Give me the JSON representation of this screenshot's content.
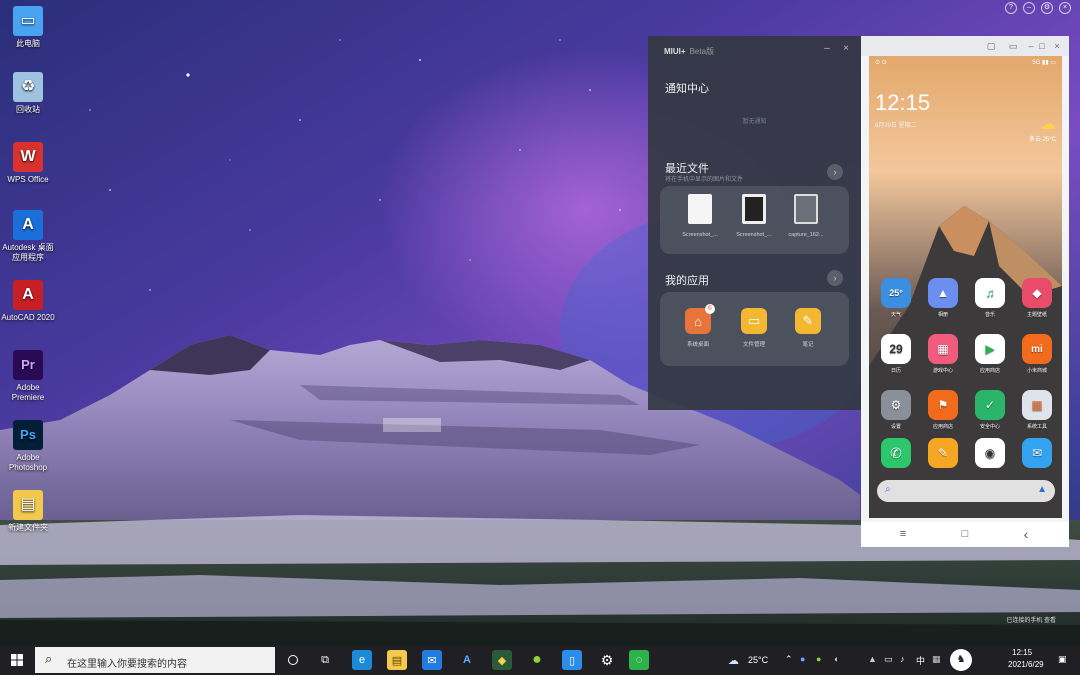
{
  "desktop": {
    "icons": [
      {
        "label": "此电脑",
        "icon": "computer-icon",
        "color": "#4aa3f0"
      },
      {
        "label": "回收站",
        "icon": "recycle-bin-icon",
        "color": "#9fc2e0"
      },
      {
        "label": "WPS Office",
        "icon": "wps-icon",
        "color": "#d9322e"
      },
      {
        "label": "Autodesk 桌面应用程序",
        "icon": "autodesk-icon",
        "color": "#1b6fd8"
      },
      {
        "label": "AutoCAD 2020",
        "icon": "autocad-icon",
        "color": "#c81f25"
      },
      {
        "label": "Adobe Premiere",
        "icon": "premiere-icon",
        "color": "#2a0a55"
      },
      {
        "label": "Adobe Photoshop",
        "icon": "photoshop-icon",
        "color": "#031e36"
      },
      {
        "label": "新建文件夹",
        "icon": "folder-icon",
        "color": "#f2c94c"
      }
    ],
    "wallpaper_label": "",
    "pc_notice": "已连接的手机 查看"
  },
  "miui_panel": {
    "title": "MIUI+",
    "beta": "Beta版",
    "notification_title": "通知中心",
    "notification_empty": "暂无通知",
    "recent_files_title": "最近文件",
    "recent_files_sub": "将在手机中显示的图片和文件",
    "files": [
      {
        "name": "Screenshot_...",
        "thumb_color": "#f5f5f5"
      },
      {
        "name": "Screenshot_...",
        "thumb_color": "#222222"
      },
      {
        "name": "capture_162...",
        "thumb_color": "#6b7078"
      }
    ],
    "my_apps_title": "我的应用",
    "apps": [
      {
        "name": "系统桌面",
        "icon": "home-icon",
        "color": "#e8743b",
        "badge": "6"
      },
      {
        "name": "文件管理",
        "icon": "folder-icon",
        "color": "#f4b731"
      },
      {
        "name": "笔记",
        "icon": "notes-icon",
        "color": "#f4b731"
      }
    ]
  },
  "phone": {
    "status_left": "⊙ ⊙",
    "status_right": "5G ▮▮ ▭",
    "time": "12:15",
    "date": "6月29日 星期二",
    "weather": "多云 25°C",
    "apps": [
      {
        "name": "天气",
        "label": "25°",
        "color": "#3a8fe0"
      },
      {
        "name": "相册",
        "label": "▲",
        "color": "#6c8ef0"
      },
      {
        "name": "音乐",
        "label": "♫",
        "color": "#2ac07b"
      },
      {
        "name": "主题壁纸",
        "label": "◆",
        "color": "#e94b6b"
      },
      {
        "name": "日历",
        "label": "29",
        "color": "#ffffff"
      },
      {
        "name": "游戏中心",
        "label": "▦",
        "color": "#f05c7e"
      },
      {
        "name": "应用商店",
        "label": "▶",
        "color": "#ffffff"
      },
      {
        "name": "小米商城",
        "label": "mi",
        "color": "#f26a1b"
      },
      {
        "name": "设置",
        "label": "⚙",
        "color": "#8a9099"
      },
      {
        "name": "应用商店",
        "label": "⚑",
        "color": "#f26a1b"
      },
      {
        "name": "安全中心",
        "label": "✓",
        "color": "#2ab56b"
      },
      {
        "name": "系统工具",
        "label": "▦",
        "color": "#dfe3ea"
      },
      {
        "name": "电话",
        "label": "✆",
        "color": "#2bc76a"
      },
      {
        "name": "便签",
        "label": "✎",
        "color": "#f5a623"
      },
      {
        "name": "相机",
        "label": "◉",
        "color": "#ffffff"
      },
      {
        "name": "信息",
        "label": "✉",
        "color": "#33a3f0"
      }
    ],
    "nav": {
      "menu": "≡",
      "home": "□",
      "back": "‹"
    }
  },
  "taskbar": {
    "search_placeholder": "在这里输入你要搜索的内容",
    "weather": "25°C",
    "ime": "中",
    "time": "12:15",
    "date": "2021/6/29",
    "apps": [
      {
        "icon": "edge-icon",
        "glyph": "e",
        "color": "#1b8ad8"
      },
      {
        "icon": "file-explorer-icon",
        "glyph": "▤",
        "color": "#f2c94c"
      },
      {
        "icon": "mail-icon",
        "glyph": "✉",
        "color": "#1f7de0"
      },
      {
        "icon": "autodesk-icon",
        "glyph": "A",
        "color": "#1b6fd8"
      },
      {
        "icon": "app-icon",
        "glyph": "◆",
        "color": "#c9a227"
      },
      {
        "icon": "browser-icon",
        "glyph": "●",
        "color": "#6dbb2e"
      },
      {
        "icon": "phone-link-icon",
        "glyph": "▯",
        "color": "#2c8de8"
      },
      {
        "icon": "settings-icon",
        "glyph": "⚙",
        "color": "#cccccc"
      },
      {
        "icon": "wechat-icon",
        "glyph": "◌",
        "color": "#2bb24c"
      }
    ]
  },
  "colors": {
    "accent": "#f26a1b",
    "panel_bg": "#343842",
    "taskbar_bg": "#1f1f24"
  }
}
